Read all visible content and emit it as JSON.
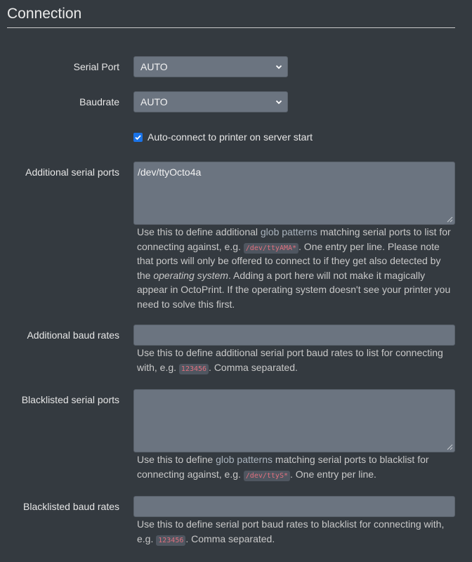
{
  "header": {
    "title": "Connection"
  },
  "serial_port": {
    "label": "Serial Port",
    "value": "AUTO"
  },
  "baudrate": {
    "label": "Baudrate",
    "value": "AUTO"
  },
  "autoconnect": {
    "checked": true,
    "label": "Auto-connect to printer on server start"
  },
  "additional_serial_ports": {
    "label": "Additional serial ports",
    "value": "/dev/ttyOcto4a",
    "help": {
      "t1": "Use this to define additional ",
      "link": "glob patterns",
      "t2": " matching serial ports to list for connecting against, e.g. ",
      "code": "/dev/ttyAMA*",
      "t3": ". One entry per line. Please note that ports will only be offered to connect to if they get also detected by the ",
      "em": "operating system",
      "t4": ". Adding a port here will not make it magically appear in OctoPrint. If the operating system doesn't see your printer you need to solve this first."
    }
  },
  "additional_baud_rates": {
    "label": "Additional baud rates",
    "value": "",
    "help": {
      "t1": "Use this to define additional serial port baud rates to list for connecting with, e.g. ",
      "code": "123456",
      "t2": ". Comma separated."
    }
  },
  "blacklisted_serial_ports": {
    "label": "Blacklisted serial ports",
    "value": "",
    "help": {
      "t1": "Use this to define ",
      "link": "glob patterns",
      "t2": " matching serial ports to blacklist for connecting against, e.g. ",
      "code": "/dev/ttyS*",
      "t3": ". One entry per line."
    }
  },
  "blacklisted_baud_rates": {
    "label": "Blacklisted baud rates",
    "value": "",
    "help": {
      "t1": "Use this to define serial port baud rates to blacklist for connecting with, e.g. ",
      "code": "123456",
      "t2": ". Comma separated."
    }
  }
}
